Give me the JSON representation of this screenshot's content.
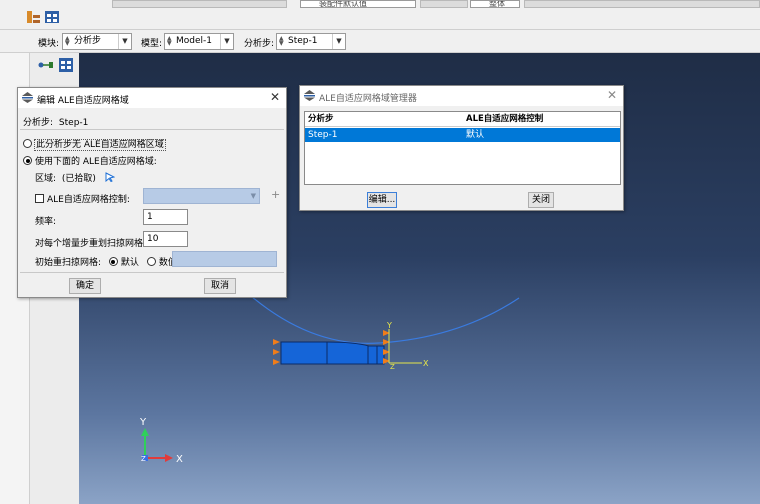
{
  "context_bar": {
    "module_label": "模块:",
    "module_value": "分析步",
    "model_label": "模型:",
    "model_value": "Model-1",
    "step_label": "分析步:",
    "step_value": "Step-1"
  },
  "toolbar": {
    "view_combo_value": "装配件默认值",
    "section_combo_value": "整体"
  },
  "edit_dialog": {
    "title": "编辑 ALE自适应网格域",
    "step_label": "分析步:",
    "step_value": "Step-1",
    "option_none": "此分析步无 ALE自适应网格区域",
    "option_use": "使用下面的 ALE自适应网格域:",
    "region_label": "区域:",
    "region_value": "(已拾取)",
    "control_label": "ALE自适应网格控制:",
    "frequency_label": "频率:",
    "frequency_value": "1",
    "sweeps_label": "对每个增量步重划扫掠网格:",
    "sweeps_value": "10",
    "initial_label": "初始重扫掠网格:",
    "initial_default": "默认",
    "initial_value": "数值:",
    "ok": "确定",
    "cancel": "取消"
  },
  "manager_dialog": {
    "title": "ALE自适应网格域管理器",
    "col_step": "分析步",
    "col_control": "ALE自适应网格控制",
    "rows": [
      {
        "step": "Step-1",
        "control": "默认"
      }
    ],
    "edit_button": "编辑...",
    "close_button": "关闭"
  },
  "viewport": {
    "triad_y": "Y",
    "triad_x": "X",
    "triad_z": "Z",
    "part_y": "Y",
    "part_x": "X",
    "part_z": "Z"
  },
  "icons": [
    "spin-icon",
    "dropdown-arrow-icon",
    "close-icon",
    "select-arrow-icon",
    "add-plus-icon",
    "abaqus-dialog-icon"
  ],
  "colors": {
    "selection": "#0078d7",
    "viewport_top": "#1f2d46",
    "viewport_bottom": "#8ba3c6",
    "part_fill": "#1565d8",
    "bc_marker": "#f07d1a",
    "curve": "#3a7be0"
  }
}
